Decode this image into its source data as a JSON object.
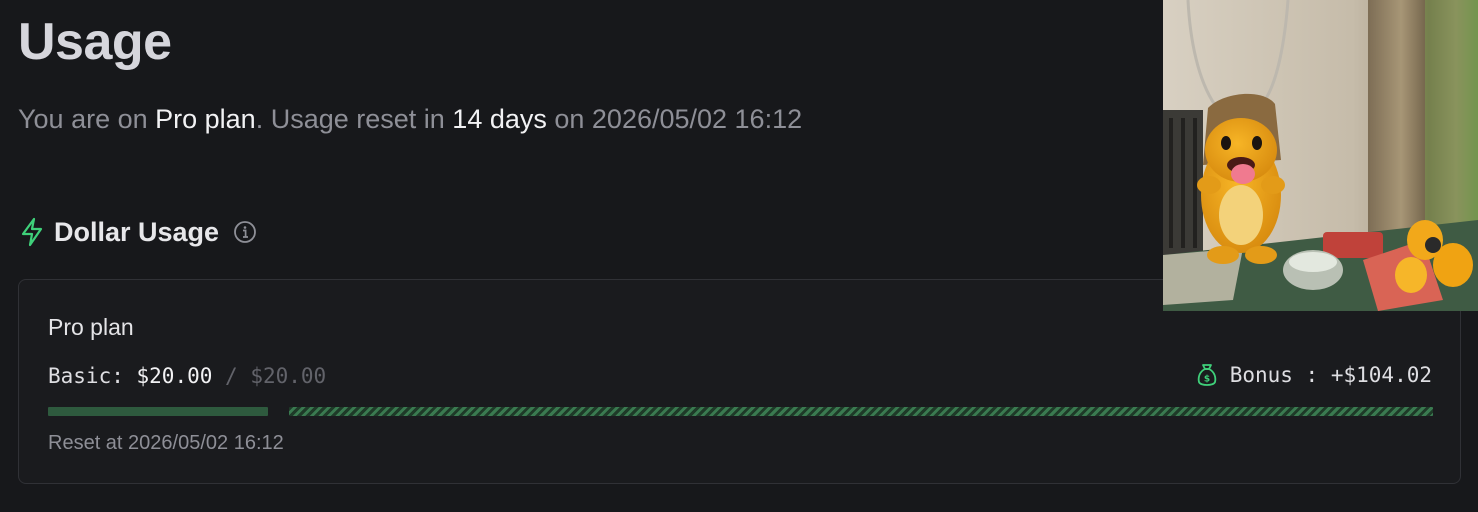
{
  "header": {
    "title": "Usage"
  },
  "summary": {
    "prefix": "You are on ",
    "plan": "Pro plan",
    "middle": ". Usage reset in ",
    "days": "14 days",
    "suffix": " on 2026/05/02 16:12"
  },
  "section": {
    "title": "Dollar Usage",
    "icon": "lightning-bolt-icon",
    "info_icon": "info-icon"
  },
  "card": {
    "plan_name": "Pro plan",
    "basic_label": "Basic:",
    "basic_used": "$20.00",
    "basic_separator": "/",
    "basic_total": "$20.00",
    "basic_fraction": 1.0,
    "bonus_icon": "money-bag-icon",
    "bonus_label": "Bonus : +$104.02",
    "reset_text": "Reset at 2026/05/02 16:12"
  },
  "colors": {
    "background": "#17181b",
    "accent_green": "#3fd07a",
    "bar_green": "#2e5a3e",
    "muted_text": "#8e8f97"
  },
  "overlay": {
    "type": "picture-in-picture video",
    "subject": "yellow lizard figurine"
  }
}
